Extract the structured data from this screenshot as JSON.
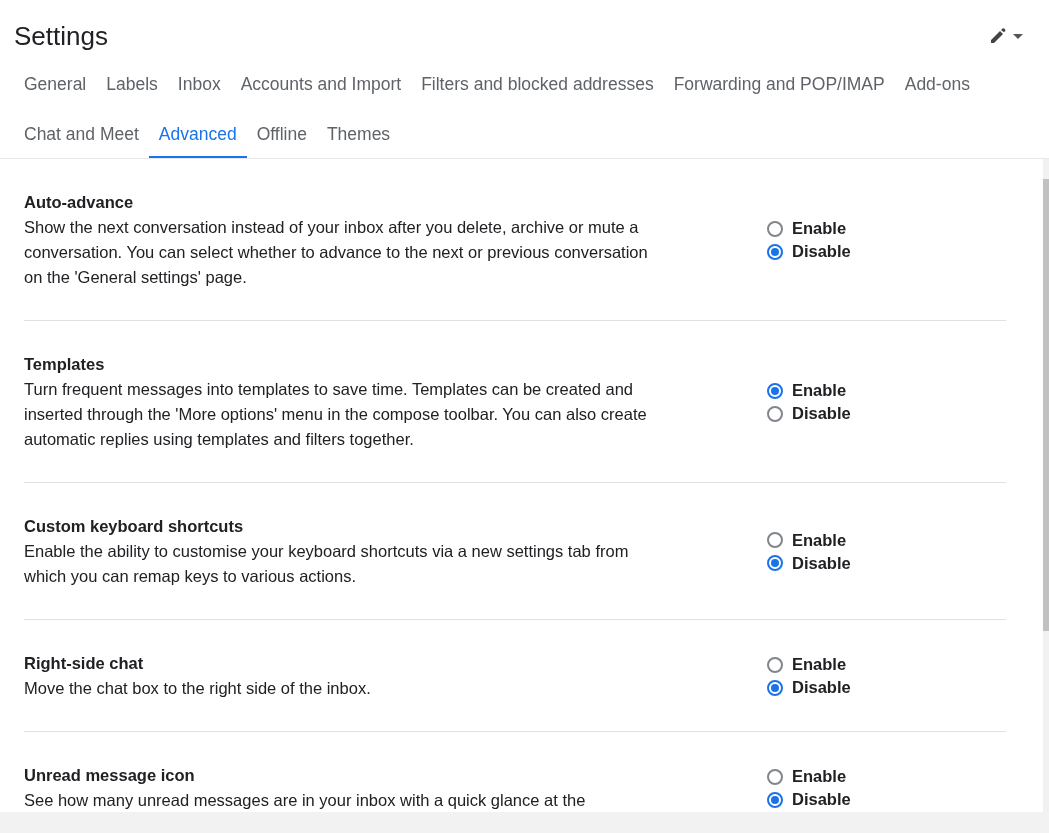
{
  "title": "Settings",
  "tabs": [
    {
      "label": "General",
      "selected": false
    },
    {
      "label": "Labels",
      "selected": false
    },
    {
      "label": "Inbox",
      "selected": false
    },
    {
      "label": "Accounts and Import",
      "selected": false
    },
    {
      "label": "Filters and blocked addresses",
      "selected": false
    },
    {
      "label": "Forwarding and POP/IMAP",
      "selected": false
    },
    {
      "label": "Add-ons",
      "selected": false
    },
    {
      "label": "Chat and Meet",
      "selected": false
    },
    {
      "label": "Advanced",
      "selected": true
    },
    {
      "label": "Offline",
      "selected": false
    },
    {
      "label": "Themes",
      "selected": false
    }
  ],
  "settings": [
    {
      "title": "Auto-advance",
      "description": "Show the next conversation instead of your inbox after you delete, archive or mute a conversation. You can select whether to advance to the next or previous conversation on the 'General settings' page.",
      "options": [
        {
          "label": "Enable",
          "selected": false
        },
        {
          "label": "Disable",
          "selected": true
        }
      ]
    },
    {
      "title": "Templates",
      "description": "Turn frequent messages into templates to save time. Templates can be created and inserted through the 'More options' menu in the compose toolbar. You can also create automatic replies using templates and filters together.",
      "options": [
        {
          "label": "Enable",
          "selected": true
        },
        {
          "label": "Disable",
          "selected": false
        }
      ]
    },
    {
      "title": "Custom keyboard shortcuts",
      "description": "Enable the ability to customise your keyboard shortcuts via a new settings tab from which you can remap keys to various actions.",
      "options": [
        {
          "label": "Enable",
          "selected": false
        },
        {
          "label": "Disable",
          "selected": true
        }
      ]
    },
    {
      "title": "Right-side chat",
      "description": "Move the chat box to the right side of the inbox.",
      "options": [
        {
          "label": "Enable",
          "selected": false
        },
        {
          "label": "Disable",
          "selected": true
        }
      ]
    },
    {
      "title": "Unread message icon",
      "description": "See how many unread messages are in your inbox with a quick glance at the",
      "options": [
        {
          "label": "Enable",
          "selected": false
        },
        {
          "label": "Disable",
          "selected": true
        }
      ]
    }
  ]
}
